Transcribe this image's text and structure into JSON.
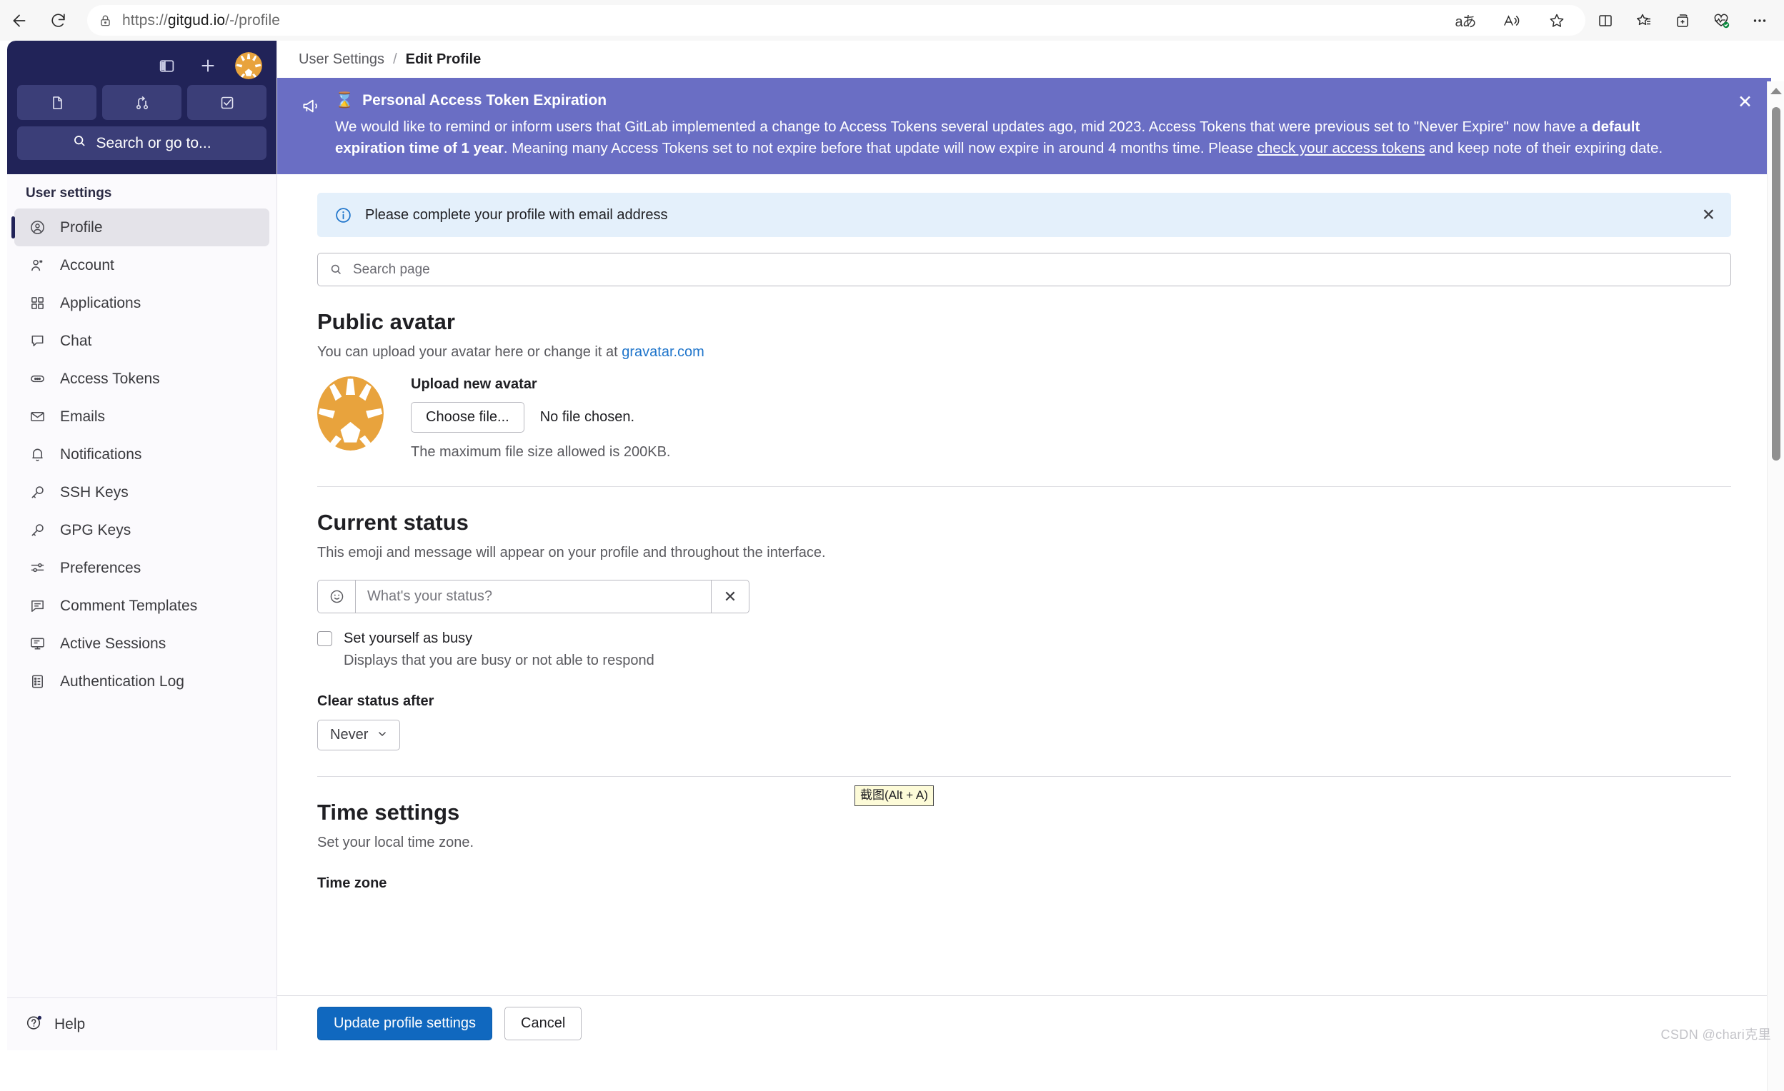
{
  "browser": {
    "url_prefix": "https://",
    "url_domain": "gitgud.io",
    "url_path": "/-/profile",
    "back_icon": "back-arrow-icon",
    "reload_icon": "reload-icon",
    "lock_icon": "lock-icon",
    "toolbar_icons": [
      "translate-icon",
      "read-aloud-icon",
      "favorite-star-icon",
      "split-screen-icon",
      "collections-icon",
      "browser-essentials-icon",
      "settings-more-icon"
    ],
    "translate_glyph": "aあ"
  },
  "sidebar": {
    "toggle_icon": "sidebar-toggle-icon",
    "new_icon": "plus-icon",
    "avatar_icon": "user-avatar",
    "quick_buttons": [
      {
        "name": "issues-button",
        "icon": "issue-icon"
      },
      {
        "name": "merge-requests-button",
        "icon": "merge-request-icon"
      },
      {
        "name": "todos-button",
        "icon": "todo-check-icon"
      }
    ],
    "search_placeholder": "Search or go to...",
    "search_icon": "search-icon",
    "section_title": "User settings",
    "items": [
      {
        "label": "Profile",
        "icon": "user-circle-icon",
        "active": true
      },
      {
        "label": "Account",
        "icon": "user-gear-icon",
        "active": false
      },
      {
        "label": "Applications",
        "icon": "applications-grid-icon",
        "active": false
      },
      {
        "label": "Chat",
        "icon": "chat-bubble-icon",
        "active": false
      },
      {
        "label": "Access Tokens",
        "icon": "token-icon",
        "active": false
      },
      {
        "label": "Emails",
        "icon": "envelope-icon",
        "active": false
      },
      {
        "label": "Notifications",
        "icon": "bell-icon",
        "active": false
      },
      {
        "label": "SSH Keys",
        "icon": "key-icon",
        "active": false
      },
      {
        "label": "GPG Keys",
        "icon": "key-icon",
        "active": false
      },
      {
        "label": "Preferences",
        "icon": "sliders-icon",
        "active": false
      },
      {
        "label": "Comment Templates",
        "icon": "comment-lines-icon",
        "active": false
      },
      {
        "label": "Active Sessions",
        "icon": "monitor-icon",
        "active": false
      },
      {
        "label": "Authentication Log",
        "icon": "log-list-icon",
        "active": false
      }
    ],
    "help_label": "Help",
    "help_icon": "question-circle-icon"
  },
  "breadcrumb": {
    "parent": "User Settings",
    "separator": "/",
    "current": "Edit Profile"
  },
  "banner": {
    "megaphone_icon": "megaphone-icon",
    "emoji": "⌛",
    "title": "Personal Access Token Expiration",
    "text_1": "We would like to remind or inform users that GitLab implemented a change to Access Tokens several updates ago, mid 2023. Access Tokens that were previous set to \"Never Expire\" now have a ",
    "bold_1": "default expiration time of 1 year",
    "text_2": ". Meaning many Access Tokens set to not expire before that update will now expire in around 4 months time. Please ",
    "link": "check your access tokens",
    "text_3": " and keep note of their expiring date.",
    "close_icon": "close-icon",
    "close_glyph": "✕",
    "bg_color": "#6a6ec4"
  },
  "alert": {
    "info_icon": "info-circle-icon",
    "message": "Please complete your profile with email address",
    "close_glyph": "✕",
    "bg_color": "#e4f0fb"
  },
  "search_page": {
    "placeholder": "Search page",
    "icon": "search-icon",
    "value": ""
  },
  "avatar_section": {
    "heading": "Public avatar",
    "description_prefix": "You can upload your avatar here or change it at ",
    "link": "gravatar.com",
    "upload_title": "Upload new avatar",
    "choose_file_label": "Choose file...",
    "no_file_text": "No file chosen.",
    "max_size_hint": "The maximum file size allowed is 200KB.",
    "avatar_color": "#e8a33d"
  },
  "status_section": {
    "heading": "Current status",
    "description": "This emoji and message will appear on your profile and throughout the interface.",
    "emoji_button_icon": "smiley-icon",
    "status_placeholder": "What's your status?",
    "status_value": "",
    "clear_glyph": "✕",
    "busy_label": "Set yourself as busy",
    "busy_hint": "Displays that you are busy or not able to respond",
    "busy_checked": false,
    "clear_after_label": "Clear status after",
    "clear_after_value": "Never",
    "chevron_icon": "chevron-down-icon"
  },
  "time_section": {
    "heading": "Time settings",
    "description": "Set your local time zone.",
    "timezone_label": "Time zone"
  },
  "footer": {
    "primary_label": "Update profile settings",
    "secondary_label": "Cancel",
    "primary_color": "#1068bf"
  },
  "tooltip": {
    "text": "截图(Alt + A)"
  },
  "watermark": {
    "text": "CSDN @chari克里"
  }
}
